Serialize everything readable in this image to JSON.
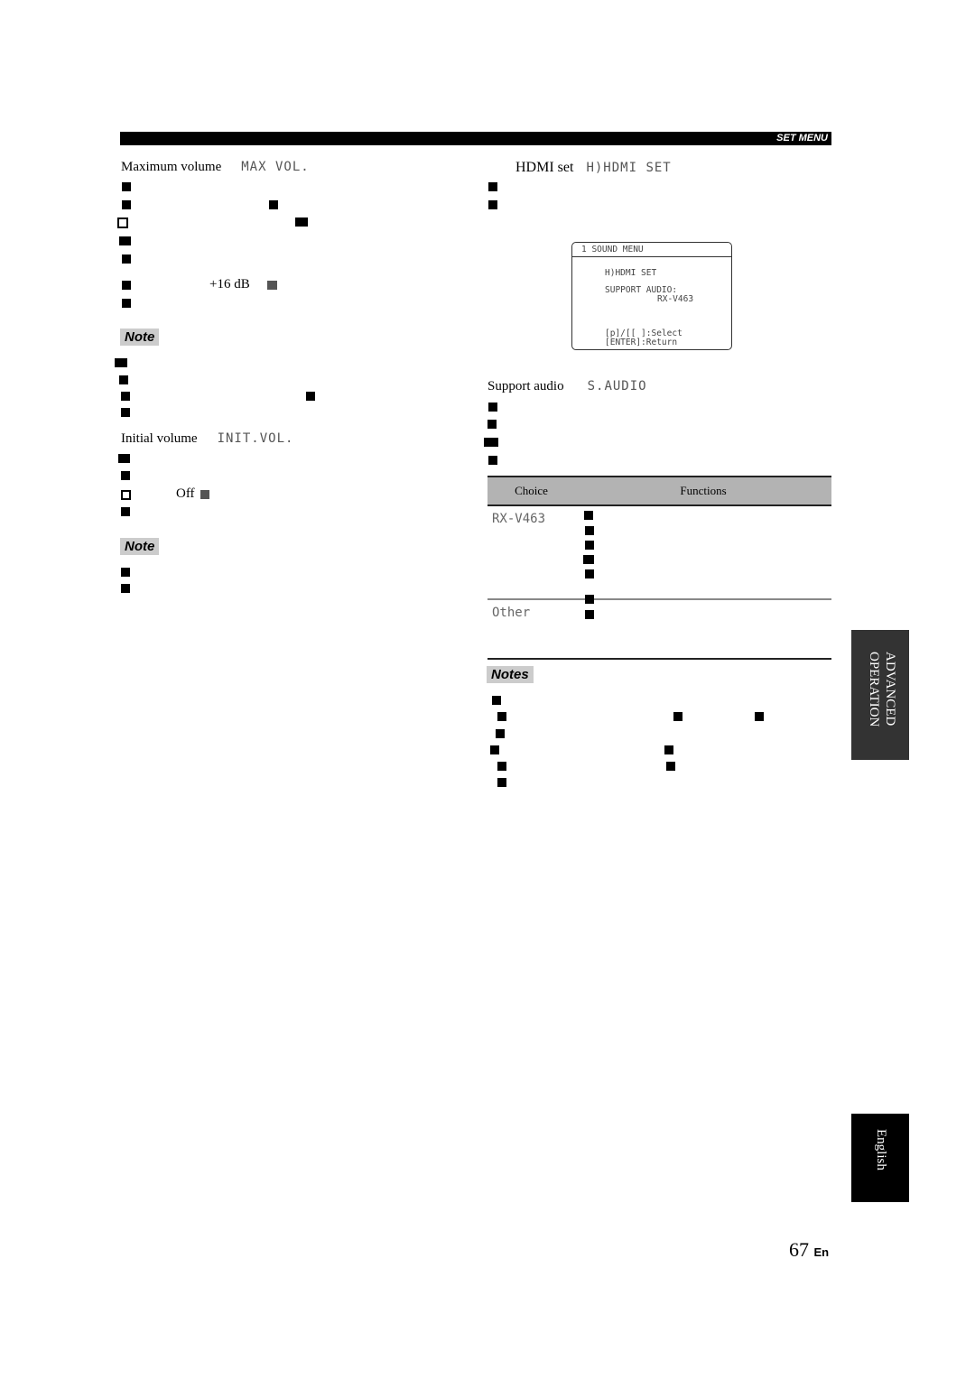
{
  "header": {
    "section_label": "SET MENU"
  },
  "left": {
    "max_volume": {
      "title": "Maximum volume",
      "lcd": "MAX VOL.",
      "value_label": "+16 dB"
    },
    "note1": {
      "label": "Note"
    },
    "initial_volume": {
      "title": "Initial volume",
      "lcd": "INIT.VOL.",
      "value_label": "Off"
    },
    "note2": {
      "label": "Note"
    }
  },
  "right": {
    "hdmi_set": {
      "title": "HDMI set",
      "lcd": "H)HDMI SET"
    },
    "screen": {
      "header": "1 SOUND MENU",
      "line1": "H)HDMI SET",
      "line2": "SUPPORT AUDIO:",
      "line3": "RX-V463",
      "line4": "[p]/[[ ]:Select",
      "line5": "[ENTER]:Return"
    },
    "support_audio": {
      "title": "Support audio",
      "lcd": "S.AUDIO"
    },
    "table": {
      "headers": [
        "Choice",
        "Functions"
      ],
      "rows": [
        {
          "choice": "RX-V463"
        },
        {
          "choice": "Other"
        }
      ]
    },
    "notes": {
      "label": "Notes"
    }
  },
  "side_tabs": {
    "section_line1": "ADVANCED",
    "section_line2": "OPERATION",
    "language": "English",
    "colors": {
      "section": "#333333",
      "language": "#000000"
    }
  },
  "footer": {
    "page_number": "67",
    "lang_code": "En"
  }
}
